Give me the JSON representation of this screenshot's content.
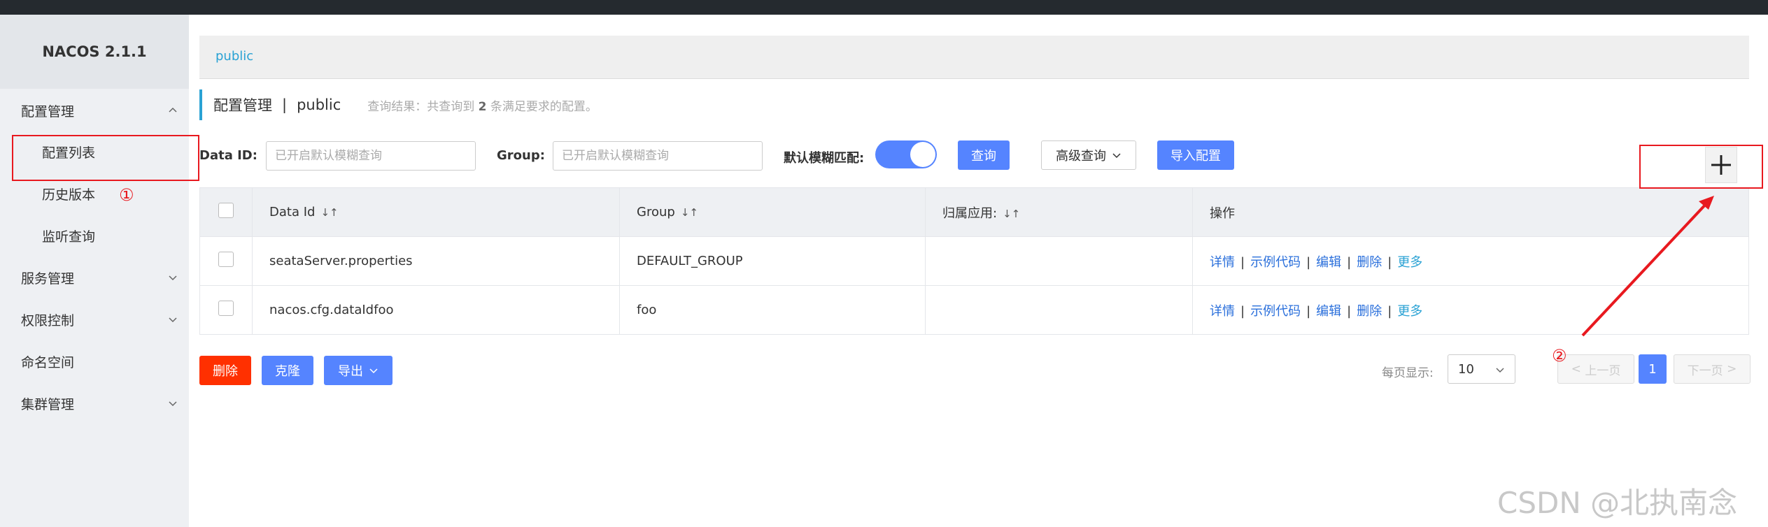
{
  "app": {
    "brand": "NACOS 2.1.1"
  },
  "sidebar": {
    "items": [
      {
        "label": "配置管理"
      },
      {
        "label": "配置列表"
      },
      {
        "label": "历史版本"
      },
      {
        "label": "监听查询"
      },
      {
        "label": "服务管理"
      },
      {
        "label": "权限控制"
      },
      {
        "label": "命名空间"
      },
      {
        "label": "集群管理"
      }
    ]
  },
  "breadcrumb": {
    "namespace": "public"
  },
  "header": {
    "title": "配置管理",
    "separator": "|",
    "namespace": "public",
    "hint_prefix": "查询结果：共查询到",
    "hint_count": "2",
    "hint_suffix": "条满足要求的配置。"
  },
  "filters": {
    "data_id_label": "Data ID:",
    "data_id_placeholder": "已开启默认模糊查询",
    "group_label": "Group:",
    "group_placeholder": "已开启默认模糊查询",
    "fuzzy_label": "默认模糊匹配:",
    "fuzzy_on": true,
    "query_button": "查询",
    "advanced_button": "高级查询",
    "import_button": "导入配置"
  },
  "add_button": {
    "icon": "plus-icon"
  },
  "table": {
    "columns": [
      "Data Id",
      "Group",
      "归属应用:",
      "操作"
    ],
    "rows": [
      {
        "data_id": "seataServer.properties",
        "group": "DEFAULT_GROUP",
        "app": ""
      },
      {
        "data_id": "nacos.cfg.dataIdfoo",
        "group": "foo",
        "app": ""
      }
    ],
    "ops": {
      "detail": "详情",
      "sample": "示例代码",
      "edit": "编辑",
      "delete": "删除",
      "more": "更多",
      "sep": "|"
    }
  },
  "bulk": {
    "delete": "删除",
    "clone": "克隆",
    "export": "导出"
  },
  "pagination": {
    "page_size_label": "每页显示:",
    "page_size": "10",
    "prev": "上一页",
    "current": "1",
    "next": "下一页"
  },
  "annotations": {
    "one": "①",
    "two": "②"
  },
  "watermark": "CSDN @北执南念",
  "colors": {
    "primary": "#5584ff",
    "danger": "#ff3000",
    "accent": "#2aa2d4",
    "annotation": "#e8191f"
  }
}
